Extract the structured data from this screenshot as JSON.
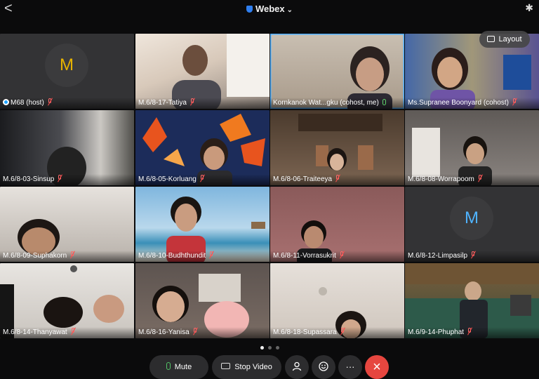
{
  "header": {
    "app_title": "Webex",
    "back": "<",
    "bt": "✱"
  },
  "layout_button": {
    "label": "Layout"
  },
  "participants": [
    {
      "name": "M68 (host)",
      "initial": "M"
    },
    {
      "name": "M.6/8-17-Tatiya"
    },
    {
      "name": "Kornkanok Wat...gku (cohost, me)"
    },
    {
      "name": "Ms.Supranee Boonyard (cohost)"
    },
    {
      "name": "M.6/8-03-Sinsup"
    },
    {
      "name": "M.6/8-05-Korluang"
    },
    {
      "name": "M.6/8-06-Traiteeya"
    },
    {
      "name": "M.6/8-08-Worrapoom"
    },
    {
      "name": "M.6/8-09-Suphakorn"
    },
    {
      "name": "M.6/8-10-Budhthundit"
    },
    {
      "name": "M.6/8-11-Vorrasukrit"
    },
    {
      "name": "M.6/8-12-Limpasilp",
      "initial": "M"
    },
    {
      "name": "M.6/8-14-Thanyawat"
    },
    {
      "name": "M.6/8-16-Yanisa"
    },
    {
      "name": "M.6/8-18-Supassara"
    },
    {
      "name": "M.6/9-14-Phuphat"
    }
  ],
  "pager": {
    "pages": 3,
    "current": 1
  },
  "controls": {
    "mute_label": "Mute",
    "stop_video_label": "Stop Video",
    "more_label": "···",
    "leave_label": "×"
  },
  "colors": {
    "accent": "#1fa3ff",
    "leave": "#e6463f",
    "muted": "#ff4d4d"
  }
}
